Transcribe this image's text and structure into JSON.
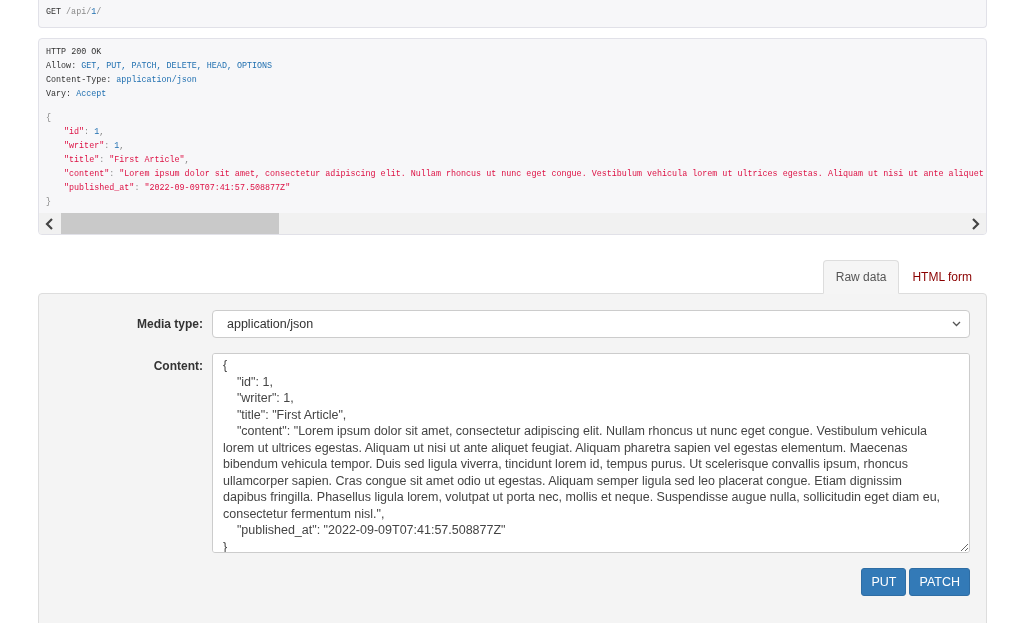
{
  "request": {
    "method": "GET",
    "path": [
      {
        "text": "/api/",
        "kind": "plain"
      },
      {
        "text": "1",
        "kind": "link"
      },
      {
        "text": "/",
        "kind": "plain"
      }
    ]
  },
  "response": {
    "status": "HTTP 200 OK",
    "headers": [
      {
        "name": "Allow:",
        "value": "GET, PUT, PATCH, DELETE, HEAD, OPTIONS"
      },
      {
        "name": "Content-Type:",
        "value": "application/json"
      },
      {
        "name": "Vary:",
        "value": "Accept"
      }
    ],
    "open": "{",
    "fields": [
      {
        "key": "\"id\"",
        "colon": ":",
        "value": "1",
        "kind": "number",
        "comma": ","
      },
      {
        "key": "\"writer\"",
        "colon": ":",
        "value": "1",
        "kind": "number",
        "comma": ","
      },
      {
        "key": "\"title\"",
        "colon": ":",
        "value": "\"First Article\"",
        "kind": "string",
        "comma": ","
      },
      {
        "key": "\"content\"",
        "colon": ":",
        "value": "\"Lorem ipsum dolor sit amet, consectetur adipiscing elit. Nullam rhoncus ut nunc eget congue. Vestibulum vehicula lorem ut ultrices egestas. Aliquam ut nisi ut ante aliquet",
        "kind": "string"
      },
      {
        "key": "\"published_at\"",
        "colon": ":",
        "value": "\"2022-09-09T07:41:57.508877Z\"",
        "kind": "string"
      }
    ],
    "close": "}"
  },
  "tabs": [
    {
      "label": "Raw data",
      "selected": true
    },
    {
      "label": "HTML form",
      "selected": false
    }
  ],
  "form": {
    "media_type": {
      "label": "Media type:",
      "value": "application/json"
    },
    "content": {
      "label": "Content:",
      "value": "{\n    \"id\": 1,\n    \"writer\": 1,\n    \"title\": \"First Article\",\n    \"content\": \"Lorem ipsum dolor sit amet, consectetur adipiscing elit. Nullam rhoncus ut nunc eget congue. Vestibulum vehicula lorem ut ultrices egestas. Aliquam ut nisi ut ante aliquet feugiat. Aliquam pharetra sapien vel egestas elementum. Maecenas bibendum vehicula tempor. Duis sed ligula viverra, tincidunt lorem id, tempus purus. Ut scelerisque convallis ipsum, rhoncus ullamcorper sapien. Cras congue sit amet odio ut egestas. Aliquam semper ligula sed leo placerat congue. Etiam dignissim dapibus fringilla. Phasellus ligula lorem, volutpat ut porta nec, mollis et neque. Suspendisse augue nulla, sollicitudin eget diam eu, consectetur fermentum nisl.\",\n    \"published_at\": \"2022-09-09T07:41:57.508877Z\"\n}"
    },
    "buttons": [
      "PUT",
      "PATCH"
    ]
  }
}
